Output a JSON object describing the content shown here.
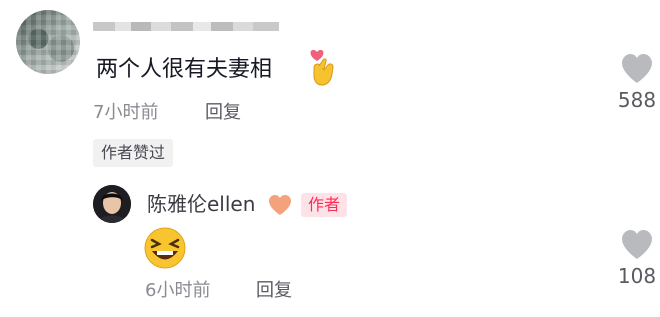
{
  "comment": {
    "text": "两个人很有夫妻相",
    "time": "7小时前",
    "reply_label": "回复",
    "author_liked_tag": "作者赞过",
    "like_count": "588",
    "emoji": "finger-heart-emoji"
  },
  "reply": {
    "username": "陈雅伦ellen",
    "author_badge": "作者",
    "name_emoji": "orange-heart-emoji",
    "content_emoji": "laughing-face-emoji",
    "time": "6小时前",
    "reply_label": "回复",
    "like_count": "108"
  },
  "colors": {
    "accent": "#fe2c55",
    "badge_bg": "#fde3e8",
    "meta_text": "#8a8b91",
    "heart_icon": "#b9babd",
    "orange_heart": "#f4a27c"
  }
}
